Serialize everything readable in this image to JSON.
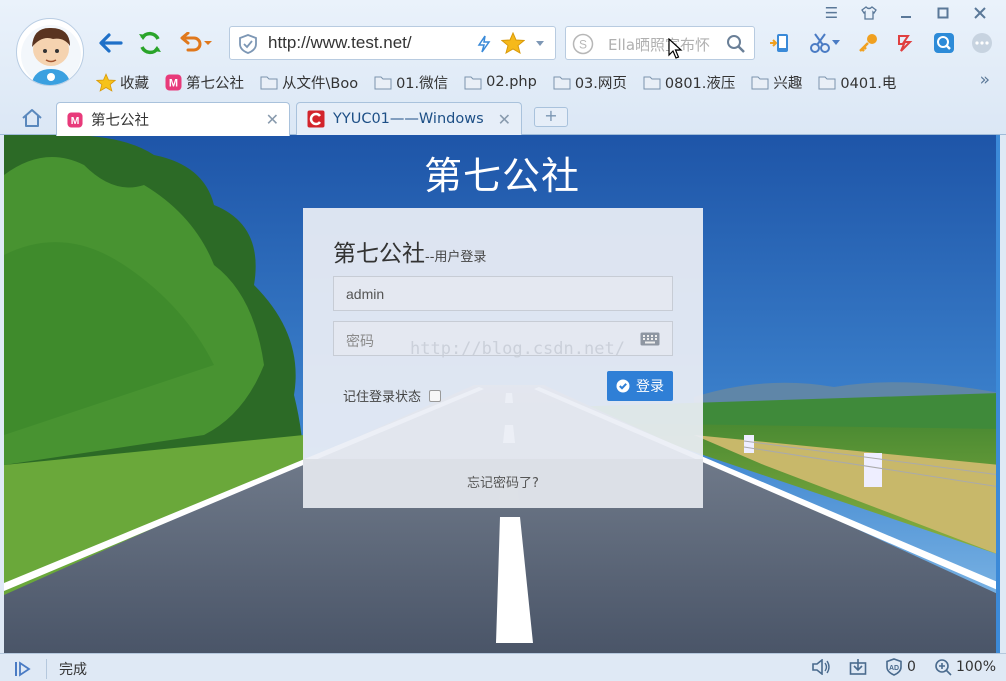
{
  "browser": {
    "address": "http://www.test.net/",
    "search_placeholder": "Ella晒照宣布怀",
    "window_controls": [
      "menu-icon",
      "skin-icon",
      "minimize-icon",
      "maximize-icon",
      "close-icon"
    ]
  },
  "bookmarks": [
    {
      "label": "收藏",
      "icon": "star-icon"
    },
    {
      "label": "第七公社",
      "icon": "site-icon"
    },
    {
      "label": "从文件\\Boo",
      "icon": "folder-icon"
    },
    {
      "label": "01.微信",
      "icon": "folder-icon"
    },
    {
      "label": "02.php",
      "icon": "folder-icon"
    },
    {
      "label": "03.网页",
      "icon": "folder-icon"
    },
    {
      "label": "0801.液压",
      "icon": "folder-icon"
    },
    {
      "label": "兴趣",
      "icon": "folder-icon"
    },
    {
      "label": "0401.电",
      "icon": "folder-icon"
    }
  ],
  "bookmarks_more": "»",
  "tabs": [
    {
      "title": "第七公社",
      "active": true
    },
    {
      "title": "YYUC01——Windows",
      "active": false
    }
  ],
  "newtab_label": "+",
  "page": {
    "site_title": "第七公社",
    "login": {
      "heading": "第七公社",
      "subheading": "--用户登录",
      "username_value": "admin",
      "password_placeholder": "密码",
      "remember_label": "记住登录状态",
      "remember_checked": false,
      "submit_label": "登录",
      "forgot_label": "忘记密码了?"
    },
    "watermark": "http://blog.csdn.net/"
  },
  "status": {
    "text": "完成",
    "blocked_count": "0",
    "zoom": "100%"
  },
  "colors": {
    "accent": "#2f7fd6",
    "chrome_bg": "#dfe9f5",
    "tab_text": "#1d4f86"
  }
}
